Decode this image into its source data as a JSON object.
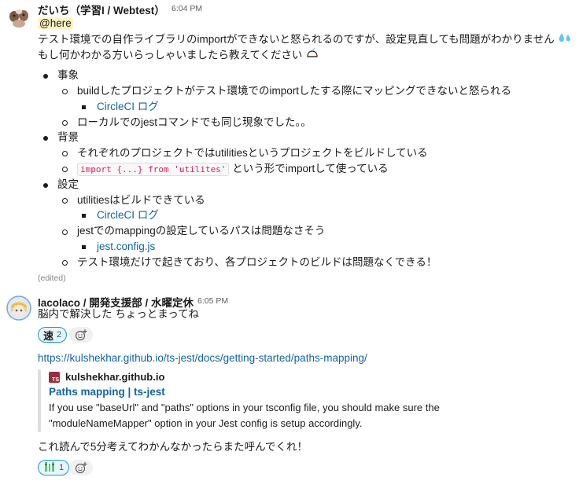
{
  "messages": [
    {
      "author": "だいち（学習I / Webtest）",
      "time": "6:04 PM",
      "mention": "@here",
      "line1": "テスト環境での自作ライブラリのimportができないと怒られるのですが、設定見直しても問題がわかりません",
      "line2": "もし何かわかる方いらっしゃいましたら教えてください",
      "list": {
        "s1": "事象",
        "s1_a": "buildしたプロジェクトがテスト環境でのimportしたする際にマッピングできないと怒られる",
        "s1_a_link": "CircleCI ログ",
        "s1_b": "ローカルでのjestコマンドでも同じ現象でした。。",
        "s2": "背景",
        "s2_a": "それぞれのプロジェクトではutilitiesというプロジェクトをビルドしている",
        "s2_b_code": "import {...} from 'utilites'",
        "s2_b_text": "という形でimportして使っている",
        "s3": "設定",
        "s3_a": "utilitiesはビルドできている",
        "s3_a_link": "CircleCI ログ",
        "s3_b": "jestでのmappingの設定しているパスは問題なさそう",
        "s3_b_link": "jest.config.js",
        "s3_c": "テスト環境だけで起きており、各プロジェクトのビルドは問題なくできる！"
      },
      "edited": "(edited)"
    },
    {
      "author": "lacolaco / 開発支援部 / 水曜定休",
      "time": "6:05 PM",
      "text1": "脳内で解決した ちょっとまってね",
      "reaction1": {
        "emoji": "速",
        "count": "2"
      },
      "link_url": "https://kulshekhar.github.io/ts-jest/docs/getting-started/paths-mapping/",
      "unfurl": {
        "badge": "TS",
        "site": "kulshekhar.github.io",
        "title": "Paths mapping | ts-jest",
        "desc1": "If you use \"baseUrl\" and \"paths\" options in your tsconfig file, you should make sure the",
        "desc2": "\"moduleNameMapper\" option in your Jest config is setup accordingly."
      },
      "text2": "これ読んで5分考えてわかんなかったらまた呼んでくれ！",
      "reaction2": {
        "count": "1"
      }
    }
  ],
  "icons": [
    "sweat-drops-icon",
    "ninja-emoji-icon",
    "add-reaction-icon",
    "ts-badge-icon",
    "alien-emoji-icon"
  ],
  "colors": {
    "link": "#1264a3",
    "mention_bg": "#fff3c4",
    "code": "#e01e5a",
    "reaction_border": "#1d9bd1"
  }
}
